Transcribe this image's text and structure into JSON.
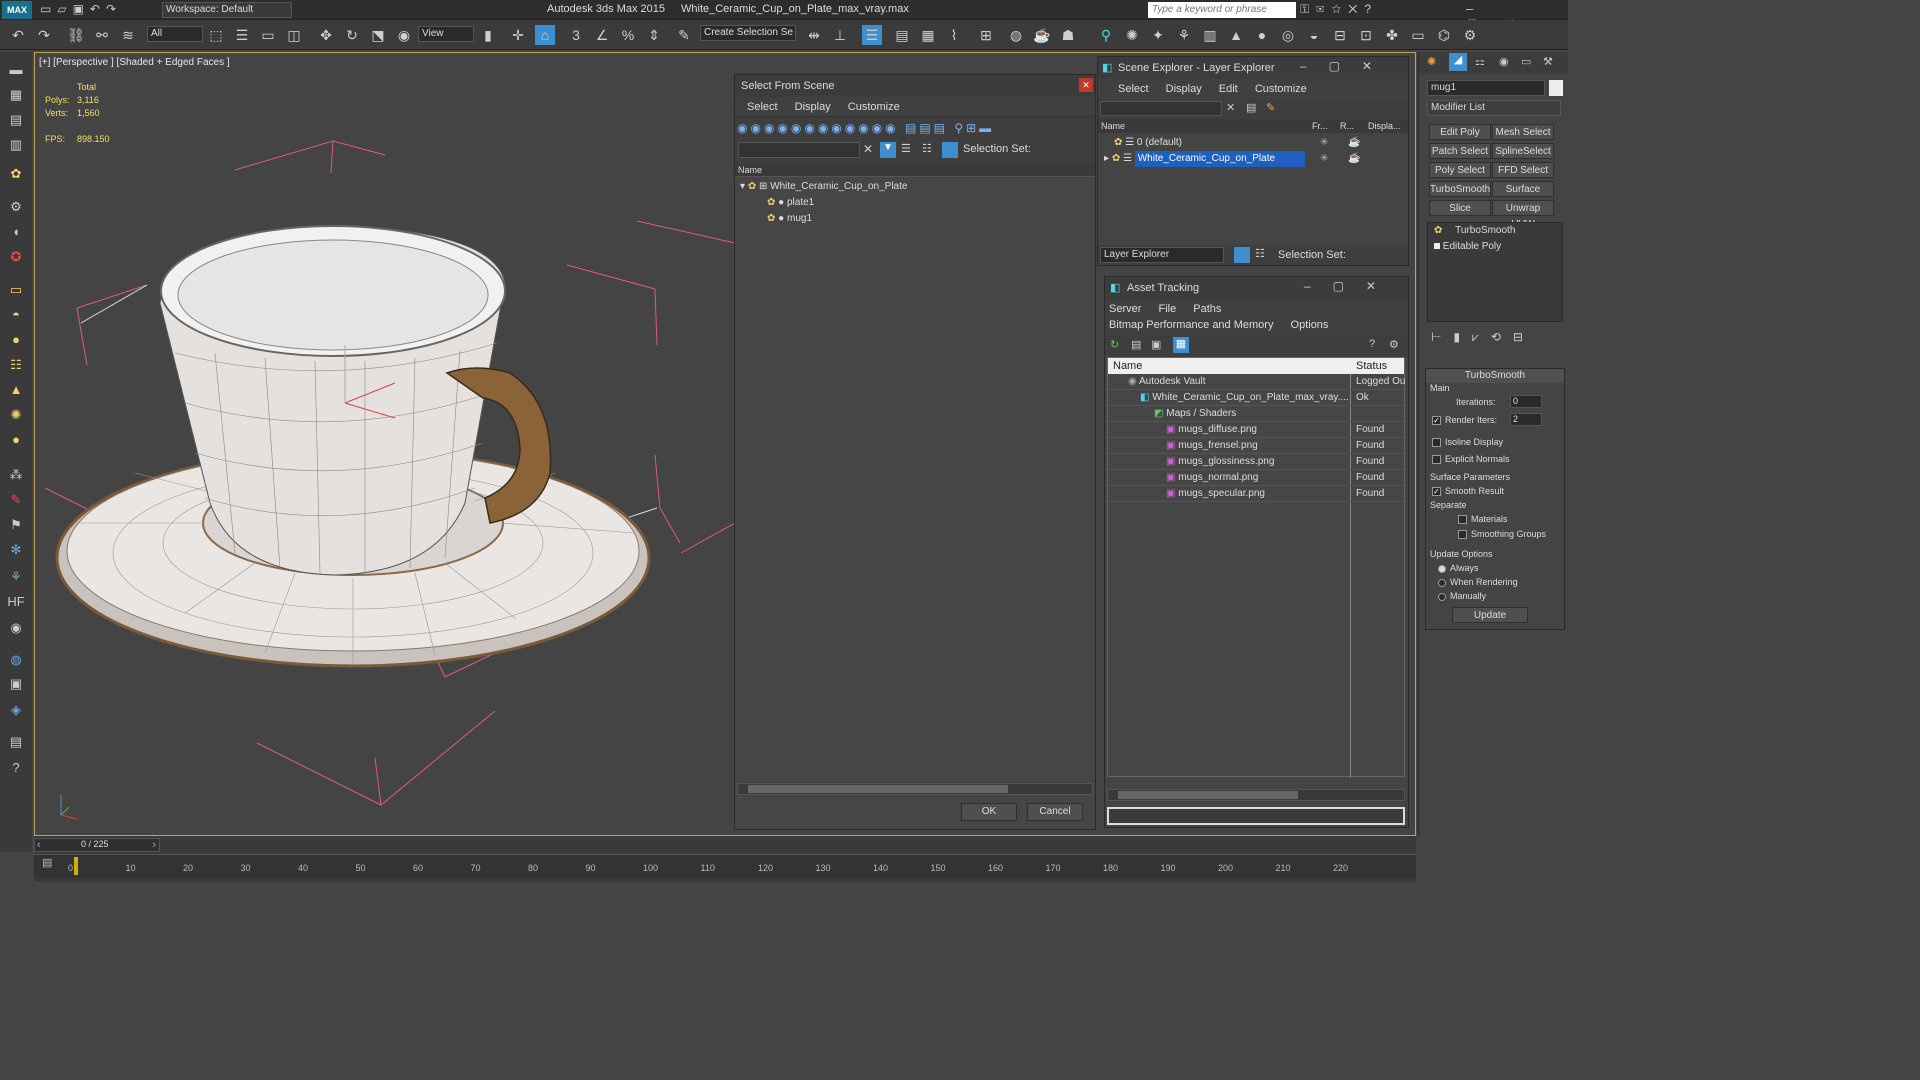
{
  "titlebar": {
    "app_badge": "MAX",
    "workspace": "Workspace: Default",
    "app": "Autodesk 3ds Max  2015",
    "file": "White_Ceramic_Cup_on_Plate_max_vray.max",
    "search_placeholder": "Type a keyword or phrase"
  },
  "toolbar": {
    "filter": "All",
    "view": "View",
    "selection_set": "Create Selection Se"
  },
  "viewport": {
    "label": "[+] [Perspective ] [Shaded + Edged Faces ]",
    "stats_header": "Total",
    "polys_label": "Polys:",
    "polys": "3,116",
    "verts_label": "Verts:",
    "verts": "1,560",
    "fps_label": "FPS:",
    "fps": "898.150"
  },
  "select_dialog": {
    "title": "Select From Scene",
    "menus": [
      "Select",
      "Display",
      "Customize"
    ],
    "selection_set_label": "Selection Set:",
    "col_name": "Name",
    "rows": [
      {
        "name": "White_Ceramic_Cup_on_Plate"
      },
      {
        "name": "plate1"
      },
      {
        "name": "mug1"
      }
    ],
    "ok": "OK",
    "cancel": "Cancel"
  },
  "scene_explorer": {
    "title": "Scene Explorer - Layer Explorer",
    "menus": [
      "Select",
      "Display",
      "Edit",
      "Customize"
    ],
    "cols": [
      "Name",
      "Fr...",
      "R...",
      "Displa..."
    ],
    "rows": [
      "0 (default)",
      "White_Ceramic_Cup_on_Plate"
    ],
    "footer_combo": "Layer Explorer",
    "selection_set_label": "Selection Set:"
  },
  "asset_tracking": {
    "title": "Asset Tracking",
    "menus": [
      "Server",
      "File",
      "Paths",
      "Bitmap Performance and Memory",
      "Options"
    ],
    "cols": [
      "Name",
      "Status"
    ],
    "rows": [
      {
        "name": "Autodesk Vault",
        "status": "Logged Ou"
      },
      {
        "name": "White_Ceramic_Cup_on_Plate_max_vray....",
        "status": "Ok"
      },
      {
        "name": "Maps / Shaders",
        "status": ""
      },
      {
        "name": "mugs_diffuse.png",
        "status": "Found"
      },
      {
        "name": "mugs_frensel.png",
        "status": "Found"
      },
      {
        "name": "mugs_glossiness.png",
        "status": "Found"
      },
      {
        "name": "mugs_normal.png",
        "status": "Found"
      },
      {
        "name": "mugs_specular.png",
        "status": "Found"
      }
    ]
  },
  "command_panel": {
    "object_name": "mug1",
    "modifier_list": "Modifier List",
    "buttons": [
      "Edit Poly",
      "Mesh Select",
      "Patch Select",
      "SplineSelect",
      "Poly Select",
      "FFD Select",
      "TurboSmooth",
      "Surface Select",
      "Slice",
      "Unwrap UVW"
    ],
    "stack": [
      "TurboSmooth",
      "Editable Poly"
    ],
    "rollout_title": "TurboSmooth",
    "main_label": "Main",
    "iterations_label": "Iterations:",
    "iterations": "0",
    "render_iters_label": "Render Iters:",
    "render_iters": "2",
    "isoline": "Isoline Display",
    "explicit_normals": "Explicit Normals",
    "surface_params": "Surface Parameters",
    "smooth_result": "Smooth Result",
    "separate": "Separate",
    "materials": "Materials",
    "smoothing_groups": "Smoothing Groups",
    "update_options": "Update Options",
    "always": "Always",
    "when_rendering": "When Rendering",
    "manually": "Manually",
    "update_button": "Update"
  },
  "timeline": {
    "frame": "0 / 225",
    "ticks": [
      "0",
      "10",
      "20",
      "30",
      "40",
      "50",
      "60",
      "70",
      "80",
      "90",
      "100",
      "110",
      "120",
      "130",
      "140",
      "150",
      "160",
      "170",
      "180",
      "190",
      "200",
      "210",
      "220"
    ]
  }
}
